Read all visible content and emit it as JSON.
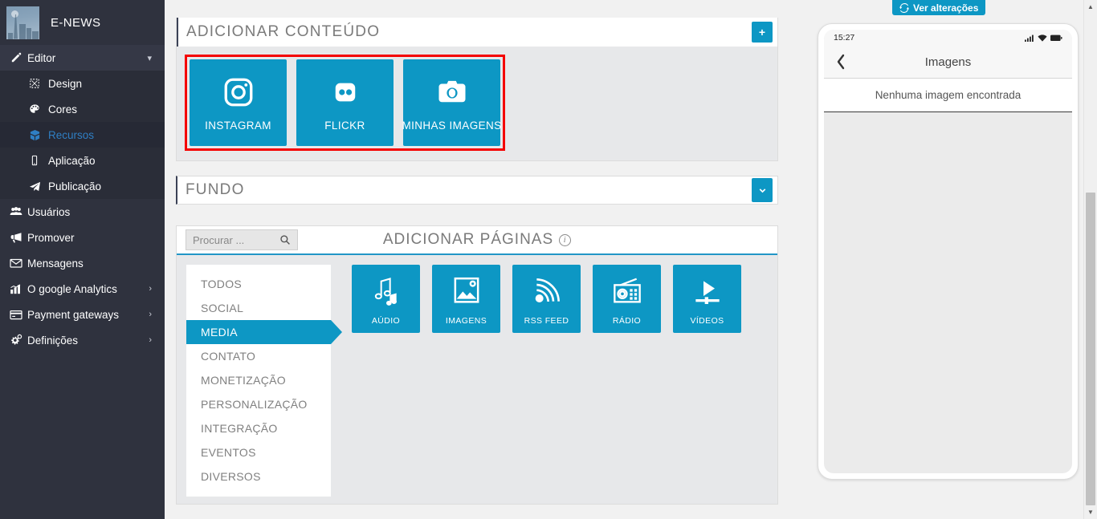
{
  "sidebar": {
    "brand": {
      "name": "E-NEWS",
      "logo_icon": "city-skyline-logo"
    },
    "groups": [
      {
        "label": "Editor",
        "icon": "pencil-icon",
        "caret": "chevron-down-icon",
        "expanded": true,
        "items": [
          {
            "label": "Design",
            "icon": "design-frame-icon",
            "active": false
          },
          {
            "label": "Cores",
            "icon": "palette-icon",
            "active": false
          },
          {
            "label": "Recursos",
            "icon": "cube-icon",
            "active": true
          },
          {
            "label": "Aplicação",
            "icon": "mobile-phone-icon",
            "active": false
          },
          {
            "label": "Publicação",
            "icon": "paper-plane-icon",
            "active": false
          }
        ]
      }
    ],
    "items": [
      {
        "label": "Usuários",
        "icon": "users-icon",
        "caret": ""
      },
      {
        "label": "Promover",
        "icon": "megaphone-icon",
        "caret": ""
      },
      {
        "label": "Mensagens",
        "icon": "envelope-icon",
        "caret": ""
      },
      {
        "label": "O google Analytics",
        "icon": "bar-chart-icon",
        "caret": "›"
      },
      {
        "label": "Payment gateways",
        "icon": "credit-card-icon",
        "caret": "›"
      },
      {
        "label": "Definições",
        "icon": "gears-icon",
        "caret": "›"
      }
    ]
  },
  "content_panel": {
    "title": "ADICIONAR CONTEÚDO",
    "add_button": "+",
    "highlighted": true,
    "tiles": [
      {
        "label": "INSTAGRAM",
        "icon": "instagram-icon"
      },
      {
        "label": "FLICKR",
        "icon": "flickr-icon"
      },
      {
        "label": "MINHAS IMAGENS",
        "icon": "camera-icon"
      }
    ]
  },
  "background_panel": {
    "title": "FUNDO",
    "expand_button": "chevron-down-icon"
  },
  "pages_panel": {
    "title": "ADICIONAR PÁGINAS",
    "info_icon": "info-circle-icon",
    "search": {
      "value": "",
      "placeholder": "Procurar ...",
      "icon": "search-icon"
    },
    "categories": [
      {
        "label": "TODOS",
        "active": false
      },
      {
        "label": "SOCIAL",
        "active": false
      },
      {
        "label": "MEDIA",
        "active": true
      },
      {
        "label": "CONTATO",
        "active": false
      },
      {
        "label": "MONETIZAÇÃO",
        "active": false
      },
      {
        "label": "PERSONALIZAÇÃO",
        "active": false
      },
      {
        "label": "INTEGRAÇÃO",
        "active": false
      },
      {
        "label": "EVENTOS",
        "active": false
      },
      {
        "label": "DIVERSOS",
        "active": false
      }
    ],
    "tiles": [
      {
        "label": "AÚDIO",
        "icon": "music-notes-icon"
      },
      {
        "label": "IMAGENS",
        "icon": "picture-icon"
      },
      {
        "label": "RSS FEED",
        "icon": "rss-icon"
      },
      {
        "label": "RÁDIO",
        "icon": "radio-icon"
      },
      {
        "label": "VÍDEOS",
        "icon": "video-play-icon"
      }
    ]
  },
  "preview": {
    "ver_button": {
      "label": "Ver alterações",
      "icon": "refresh-icon"
    },
    "phone": {
      "status_time": "15:27",
      "status_icons": [
        "signal-bars-icon",
        "wifi-icon",
        "battery-icon"
      ],
      "back_icon": "chevron-left-icon",
      "nav_title": "Imagens",
      "empty_message": "Nenhuma imagem encontrada"
    }
  },
  "scrollbar": {
    "up_arrow": "▲",
    "down_arrow": "▼"
  },
  "colors": {
    "accent": "#0d97c4",
    "sidebar_bg": "#2f323e",
    "highlight_border": "#f40000",
    "active_link": "#2f7fc4",
    "panel_bg": "#e7e8ea"
  }
}
